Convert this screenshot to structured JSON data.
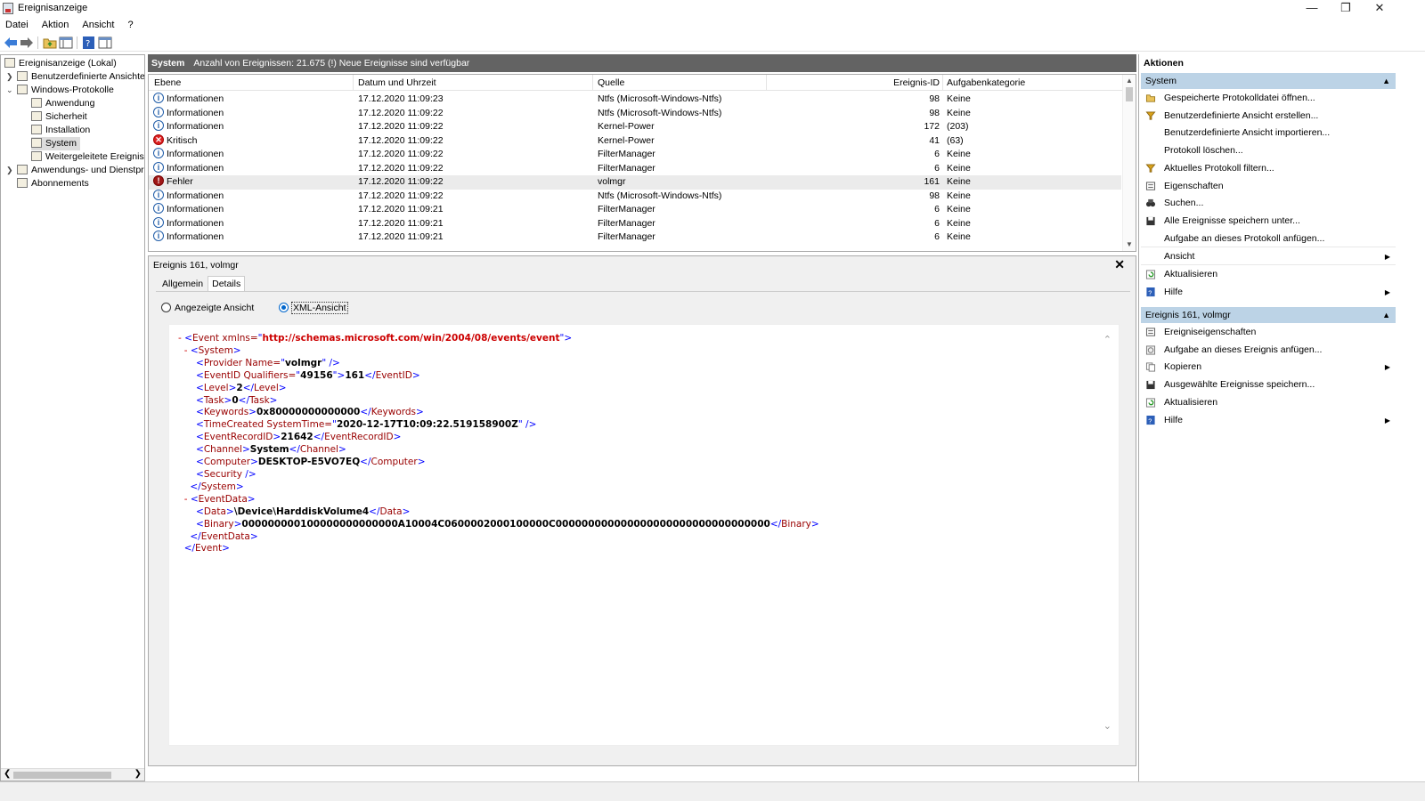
{
  "window": {
    "title": "Ereignisanzeige"
  },
  "menu": [
    "Datei",
    "Aktion",
    "Ansicht",
    "?"
  ],
  "tree": [
    {
      "label": "Ereignisanzeige (Lokal)",
      "indent": 0
    },
    {
      "label": "Benutzerdefinierte Ansichten",
      "indent": 1
    },
    {
      "label": "Windows-Protokolle",
      "indent": 1
    },
    {
      "label": "Anwendung",
      "indent": 2
    },
    {
      "label": "Sicherheit",
      "indent": 2
    },
    {
      "label": "Installation",
      "indent": 2
    },
    {
      "label": "System",
      "indent": 2,
      "selected": true
    },
    {
      "label": "Weitergeleitete Ereignisse",
      "indent": 2
    },
    {
      "label": "Anwendungs- und Dienstprotokolle",
      "indent": 1
    },
    {
      "label": "Abonnements",
      "indent": 1
    }
  ],
  "eventlist": {
    "log_name": "System",
    "count_text": "Anzahl von Ereignissen: 21.675 (!) Neue Ereignisse sind verfügbar",
    "columns": [
      "Ebene",
      "Datum und Uhrzeit",
      "Quelle",
      "Ereignis-ID",
      "Aufgabenkategorie"
    ],
    "rows": [
      {
        "level": "Informationen",
        "type": "info",
        "date": "17.12.2020 11:09:23",
        "source": "Ntfs (Microsoft-Windows-Ntfs)",
        "id": "98",
        "category": "Keine"
      },
      {
        "level": "Informationen",
        "type": "info",
        "date": "17.12.2020 11:09:22",
        "source": "Ntfs (Microsoft-Windows-Ntfs)",
        "id": "98",
        "category": "Keine"
      },
      {
        "level": "Informationen",
        "type": "info",
        "date": "17.12.2020 11:09:22",
        "source": "Kernel-Power",
        "id": "172",
        "category": "(203)"
      },
      {
        "level": "Kritisch",
        "type": "crit",
        "date": "17.12.2020 11:09:22",
        "source": "Kernel-Power",
        "id": "41",
        "category": "(63)"
      },
      {
        "level": "Informationen",
        "type": "info",
        "date": "17.12.2020 11:09:22",
        "source": "FilterManager",
        "id": "6",
        "category": "Keine"
      },
      {
        "level": "Informationen",
        "type": "info",
        "date": "17.12.2020 11:09:22",
        "source": "FilterManager",
        "id": "6",
        "category": "Keine"
      },
      {
        "level": "Fehler",
        "type": "err",
        "date": "17.12.2020 11:09:22",
        "source": "volmgr",
        "id": "161",
        "category": "Keine",
        "selected": true
      },
      {
        "level": "Informationen",
        "type": "info",
        "date": "17.12.2020 11:09:22",
        "source": "Ntfs (Microsoft-Windows-Ntfs)",
        "id": "98",
        "category": "Keine"
      },
      {
        "level": "Informationen",
        "type": "info",
        "date": "17.12.2020 11:09:21",
        "source": "FilterManager",
        "id": "6",
        "category": "Keine"
      },
      {
        "level": "Informationen",
        "type": "info",
        "date": "17.12.2020 11:09:21",
        "source": "FilterManager",
        "id": "6",
        "category": "Keine"
      },
      {
        "level": "Informationen",
        "type": "info",
        "date": "17.12.2020 11:09:21",
        "source": "FilterManager",
        "id": "6",
        "category": "Keine"
      }
    ]
  },
  "detail": {
    "title": "Ereignis 161, volmgr",
    "tabs": [
      "Allgemein",
      "Details"
    ],
    "radio_friendly": "Angezeigte Ansicht",
    "radio_xml": "XML-Ansicht",
    "xml": {
      "event_open": "Event xmlns=",
      "event_ns": "http://schemas.microsoft.com/win/2004/08/events/event",
      "provider_name": "volmgr",
      "event_qualifiers": "49156",
      "event_id": "161",
      "level": "2",
      "task": "0",
      "keywords": "0x80000000000000",
      "time_created": "2020-12-17T10:09:22.519158900Z",
      "event_record_id": "21642",
      "channel": "System",
      "computer": "DESKTOP-E5VO7EQ",
      "data": "\\Device\\HarddiskVolume4",
      "binary": "000000000100000000000000A10004C0600002000100000C000000000000000000000000000000000"
    }
  },
  "actions": {
    "title": "Aktionen",
    "section1": "System",
    "items1": [
      {
        "label": "Gespeicherte Protokolldatei öffnen...",
        "icon": "folder-icon"
      },
      {
        "label": "Benutzerdefinierte Ansicht erstellen...",
        "icon": "filter-icon"
      },
      {
        "label": "Benutzerdefinierte Ansicht importieren...",
        "icon": ""
      },
      {
        "label": "Protokoll löschen...",
        "icon": ""
      },
      {
        "label": "Aktuelles Protokoll filtern...",
        "icon": "filter-icon"
      },
      {
        "label": "Eigenschaften",
        "icon": "properties-icon"
      },
      {
        "label": "Suchen...",
        "icon": "binoculars-icon"
      },
      {
        "label": "Alle Ereignisse speichern unter...",
        "icon": "save-icon"
      },
      {
        "label": "Aufgabe an dieses Protokoll anfügen...",
        "icon": ""
      },
      {
        "label": "Ansicht",
        "icon": "",
        "submenu": true
      },
      {
        "label": "Aktualisieren",
        "icon": "refresh-icon"
      },
      {
        "label": "Hilfe",
        "icon": "help-icon",
        "submenu": true
      }
    ],
    "section2": "Ereignis 161, volmgr",
    "items2": [
      {
        "label": "Ereigniseigenschaften",
        "icon": "properties-icon"
      },
      {
        "label": "Aufgabe an dieses Ereignis anfügen...",
        "icon": "task-icon"
      },
      {
        "label": "Kopieren",
        "icon": "copy-icon",
        "submenu": true
      },
      {
        "label": "Ausgewählte Ereignisse speichern...",
        "icon": "save-icon"
      },
      {
        "label": "Aktualisieren",
        "icon": "refresh-icon"
      },
      {
        "label": "Hilfe",
        "icon": "help-icon",
        "submenu": true
      }
    ]
  },
  "colors": {
    "header_bg": "#636363",
    "section_bg": "#bcd3e6",
    "xml_tag": "#990000",
    "xml_bracket": "#0000ff",
    "selected_row": "#ebebeb"
  }
}
